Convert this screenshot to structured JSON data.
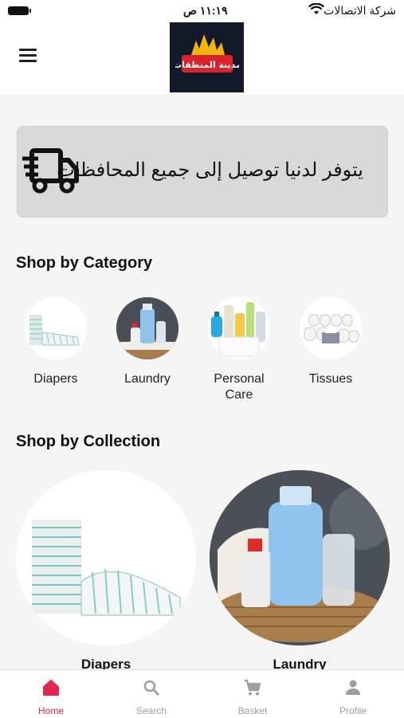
{
  "status_bar": {
    "carrier": "شركة الاتصالات",
    "time": "١١:١٩ ص"
  },
  "header": {
    "logo_text": "مدينة المنظفات"
  },
  "banner": {
    "text": "يتوفر لدنيا توصيل إلى جميع المحافظات",
    "icon": "delivery-truck-icon"
  },
  "categories": {
    "title": "Shop by Category",
    "items": [
      {
        "label": "Diapers",
        "icon": "diapers-image"
      },
      {
        "label": "Laundry",
        "icon": "laundry-image"
      },
      {
        "label": "Personal Care",
        "icon": "personal-care-image"
      },
      {
        "label": "Tissues",
        "icon": "tissues-image"
      }
    ]
  },
  "collections": {
    "title": "Shop by Collection",
    "items": [
      {
        "label": "Diapers"
      },
      {
        "label": "Laundry"
      }
    ]
  },
  "bottom_nav": {
    "items": [
      {
        "label": "Home",
        "icon": "home-icon",
        "active": true
      },
      {
        "label": "Search",
        "icon": "search-icon",
        "active": false
      },
      {
        "label": "Basket",
        "icon": "cart-icon",
        "active": false
      },
      {
        "label": "Profile",
        "icon": "person-icon",
        "active": false
      }
    ]
  },
  "colors": {
    "accent": "#e2264d",
    "inactive": "#9e9e9e",
    "background": "#f5f5f5",
    "banner": "#d9d9d9"
  }
}
